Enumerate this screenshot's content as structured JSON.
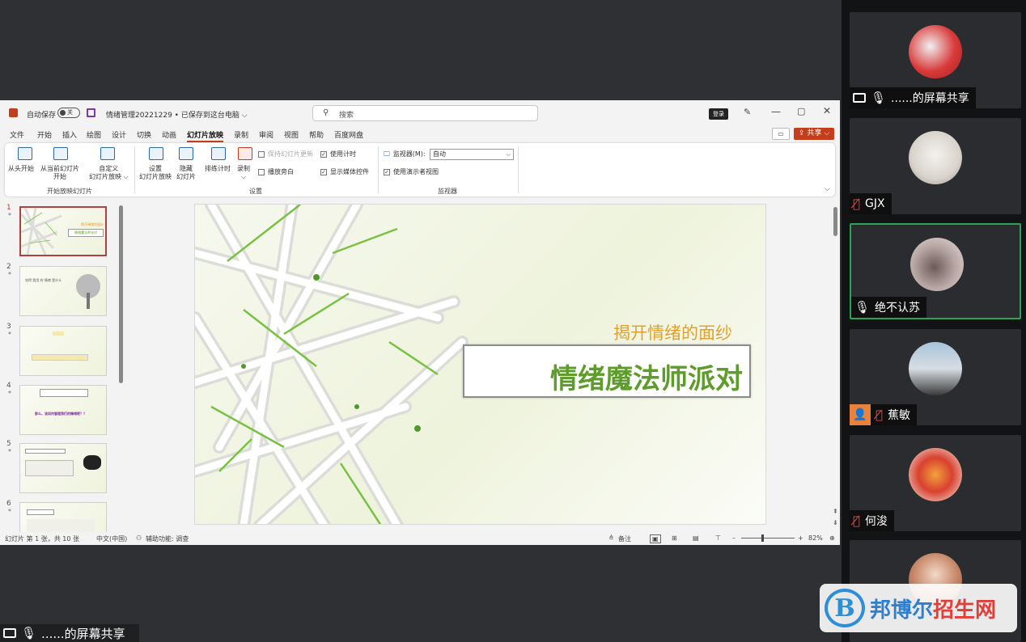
{
  "ppt": {
    "titlebar": {
      "autosave_label": "自动保存",
      "autosave_state": "关",
      "doc_title": "情绪管理20221229 • 已保存到这台电脑 ⌵",
      "search_placeholder": "搜索",
      "login_label": "登录"
    },
    "menu_tabs": [
      "文件",
      "开始",
      "插入",
      "绘图",
      "设计",
      "切换",
      "动画",
      "幻灯片放映",
      "录制",
      "审阅",
      "视图",
      "帮助",
      "百度网盘"
    ],
    "active_tab": "幻灯片放映",
    "share_label": "共享",
    "ribbon": {
      "from_start": "从头开始",
      "from_current_1": "从当前幻灯片",
      "from_current_2": "开始",
      "custom_1": "自定义",
      "custom_2": "幻灯片放映 ⌵",
      "setup_1": "设置",
      "setup_2": "幻灯片放映",
      "hide_1": "隐藏",
      "hide_2": "幻灯片",
      "rehearse": "排练计时",
      "record_1": "录制",
      "record_2": "⌵",
      "keep_updated": "保持幻灯片更新",
      "play_narration": "播放旁白",
      "use_timings": "使用计时",
      "show_media": "显示媒体控件",
      "monitor_label": "监视器(M):",
      "monitor_value": "自动",
      "presenter_view": "使用演示者视图",
      "group_start": "开始放映幻灯片",
      "group_setup": "设置",
      "group_monitor": "监视器"
    },
    "thumbnails": [
      {
        "num": "1",
        "star": "*",
        "mini_sub": "揭开情绪的面纱",
        "mini_title": "情绪魔法师派对"
      },
      {
        "num": "2",
        "star": "*",
        "text": "觉得 我用 的 情绪 是什么"
      },
      {
        "num": "3",
        "star": "*",
        "text": ""
      },
      {
        "num": "4",
        "star": "*",
        "text": "那么，该如何管理我们的情绪呢？？"
      },
      {
        "num": "5",
        "star": "*",
        "text": ""
      },
      {
        "num": "6",
        "star": "*",
        "text": ""
      }
    ],
    "slide": {
      "subtitle": "揭开情绪的面纱",
      "title": "情绪魔法师派对"
    },
    "status": {
      "slide_info": "幻灯片 第 1 张，共 10 张",
      "language": "中文(中国)",
      "accessibility": "辅助功能: 调查",
      "notes": "备注",
      "zoom": "82%"
    }
  },
  "bottom_share_label": "......的屏幕共享",
  "participants": [
    {
      "name": "......的屏幕共享",
      "mic": "on",
      "screen": true,
      "active": false
    },
    {
      "name": "GJX",
      "mic": "off",
      "screen": false,
      "active": false
    },
    {
      "name": "绝不认苏",
      "mic": "on",
      "screen": false,
      "active": true
    },
    {
      "name": "蕉敏",
      "mic": "off",
      "screen": false,
      "active": false,
      "person_icon": true
    },
    {
      "name": "何浚",
      "mic": "off",
      "screen": false,
      "active": false
    },
    {
      "name": "",
      "mic": "off",
      "screen": false,
      "active": false
    }
  ],
  "watermark": {
    "logo_letter": "B",
    "text_part1": "邦博尔",
    "text_part2": "招生网"
  },
  "colors": {
    "ppt_accent": "#c43e1c",
    "slide_title": "#5e9c2b",
    "slide_subtitle": "#e2a12b",
    "active_speaker": "#27a35a",
    "mic_off": "#e94b4b"
  }
}
